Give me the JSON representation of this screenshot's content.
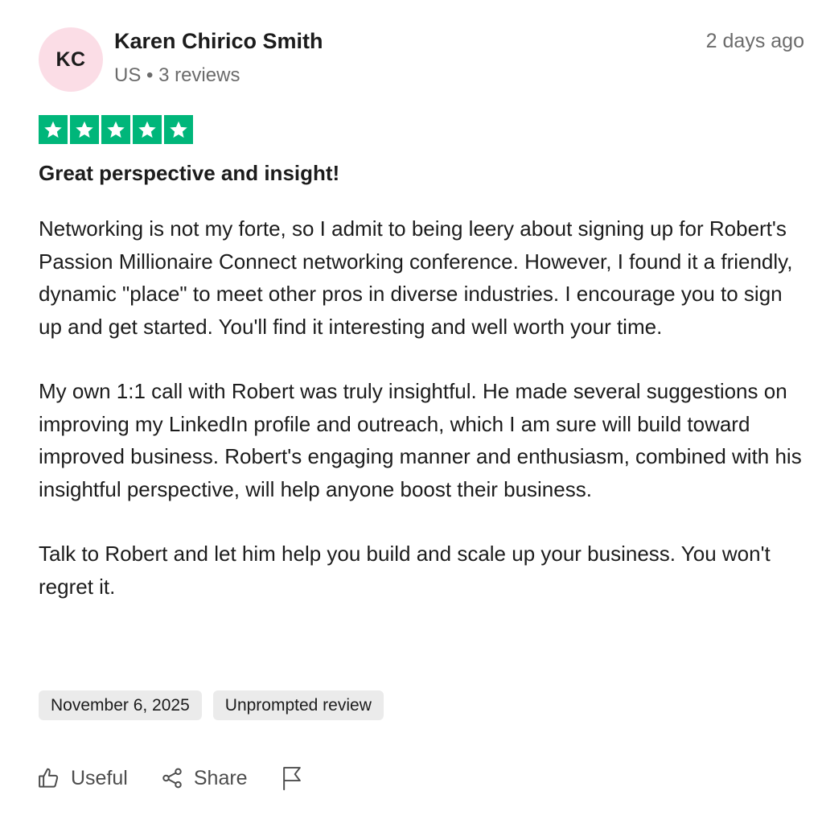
{
  "reviewer": {
    "initials": "KC",
    "name": "Karen Chirico Smith",
    "meta": "US • 3 reviews",
    "avatar_color": "#fbdde6"
  },
  "review": {
    "relative_date": "2 days ago",
    "rating": 5,
    "star_color": "#00b67a",
    "title": "Great perspective and insight!",
    "paragraphs": [
      "Networking is not my forte, so I admit to being leery about signing up for Robert's Passion Millionaire Connect networking conference. However, I found it a friendly, dynamic \"place\" to meet other pros in diverse industries. I encourage you to sign up and get started. You'll find it interesting and well worth your time.",
      "My own 1:1 call with Robert was truly insightful. He made several suggestions on improving my LinkedIn profile and outreach, which I am sure will build toward improved business. Robert's engaging manner and enthusiasm, combined with his insightful perspective, will help anyone boost their business.",
      "Talk to Robert and let him help you build and scale up your business. You won't regret it."
    ]
  },
  "tags": {
    "date": "November 6, 2025",
    "type": "Unprompted review"
  },
  "actions": {
    "useful_label": "Useful",
    "useful_icon": "thumbs-up-icon",
    "share_label": "Share",
    "share_icon": "share-icon",
    "report_icon": "flag-icon"
  }
}
